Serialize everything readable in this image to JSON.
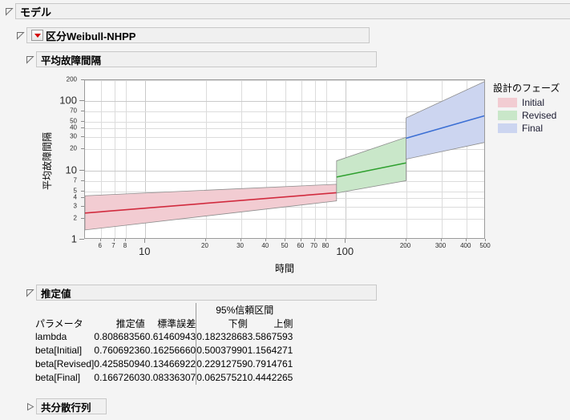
{
  "window": {
    "background": "#f4f4f4"
  },
  "outline": {
    "model": {
      "label": "モデル",
      "expanded": true
    },
    "weibull": {
      "label": "区分Weibull-NHPP",
      "expanded": true,
      "has_red_menu": true
    },
    "mtbf": {
      "label": "平均故障間隔",
      "expanded": true
    },
    "estimates": {
      "label": "推定値",
      "expanded": true
    },
    "covariance": {
      "label": "共分散行列",
      "expanded": false
    }
  },
  "chart_data": {
    "type": "line",
    "title": "平均故障間隔",
    "xlabel": "時間",
    "ylabel": "平均故障間隔",
    "xscale": "log",
    "yscale": "log",
    "xlim": [
      5,
      500
    ],
    "ylim": [
      1,
      200
    ],
    "grid": true,
    "legend_position": "right",
    "legend_title": "設計のフェーズ",
    "x_ticks": [
      {
        "value": 6,
        "label": "6",
        "size": "small"
      },
      {
        "value": 7,
        "label": "7",
        "size": "small"
      },
      {
        "value": 8,
        "label": "8",
        "size": "small"
      },
      {
        "value": 10,
        "label": "10",
        "size": "big"
      },
      {
        "value": 20,
        "label": "20",
        "size": "small"
      },
      {
        "value": 30,
        "label": "30",
        "size": "small"
      },
      {
        "value": 40,
        "label": "40",
        "size": "small"
      },
      {
        "value": 50,
        "label": "50",
        "size": "small"
      },
      {
        "value": 60,
        "label": "60",
        "size": "small"
      },
      {
        "value": 70,
        "label": "70",
        "size": "small"
      },
      {
        "value": 80,
        "label": "80",
        "size": "small"
      },
      {
        "value": 100,
        "label": "100",
        "size": "big"
      },
      {
        "value": 200,
        "label": "200",
        "size": "small"
      },
      {
        "value": 300,
        "label": "300",
        "size": "small"
      },
      {
        "value": 400,
        "label": "400",
        "size": "small"
      },
      {
        "value": 500,
        "label": "500",
        "size": "small"
      }
    ],
    "y_ticks": [
      {
        "value": 1,
        "label": "1",
        "size": "big"
      },
      {
        "value": 2,
        "label": "2",
        "size": "small"
      },
      {
        "value": 3,
        "label": "3",
        "size": "small"
      },
      {
        "value": 4,
        "label": "4",
        "size": "small"
      },
      {
        "value": 5,
        "label": "5",
        "size": "small"
      },
      {
        "value": 7,
        "label": "7",
        "size": "small"
      },
      {
        "value": 10,
        "label": "10",
        "size": "big"
      },
      {
        "value": 20,
        "label": "20",
        "size": "small"
      },
      {
        "value": 30,
        "label": "30",
        "size": "small"
      },
      {
        "value": 40,
        "label": "40",
        "size": "small"
      },
      {
        "value": 50,
        "label": "50",
        "size": "small"
      },
      {
        "value": 70,
        "label": "70",
        "size": "small"
      },
      {
        "value": 100,
        "label": "100",
        "size": "big"
      },
      {
        "value": 200,
        "label": "200",
        "size": "small"
      }
    ],
    "series": [
      {
        "name": "Initial",
        "line_color": "#d12b3e",
        "band_color": "#f2ccd2",
        "x_start": 5.0,
        "x_end": 90.0,
        "fit": [
          [
            5.0,
            2.42
          ],
          [
            90.0,
            4.75
          ]
        ],
        "lower": [
          [
            5.0,
            1.38
          ],
          [
            90.0,
            3.62
          ]
        ],
        "upper": [
          [
            5.0,
            4.3
          ],
          [
            90.0,
            6.3
          ]
        ]
      },
      {
        "name": "Revised",
        "line_color": "#2fa02f",
        "band_color": "#c9e7c9",
        "x_start": 90.0,
        "x_end": 200.0,
        "fit": [
          [
            90.0,
            8.0
          ],
          [
            200.0,
            12.8
          ]
        ],
        "lower": [
          [
            90.0,
            4.7
          ],
          [
            200.0,
            7.1
          ]
        ],
        "upper": [
          [
            90.0,
            13.7
          ],
          [
            200.0,
            30.0
          ]
        ]
      },
      {
        "name": "Final",
        "line_color": "#3b6fd4",
        "band_color": "#ccd5f0",
        "x_start": 200.0,
        "x_end": 500.0,
        "fit": [
          [
            200.0,
            29.0
          ],
          [
            500.0,
            62.0
          ]
        ],
        "lower": [
          [
            200.0,
            14.5
          ],
          [
            500.0,
            25.5
          ]
        ],
        "upper": [
          [
            200.0,
            57.0
          ],
          [
            500.0,
            195.0
          ]
        ]
      }
    ],
    "legend_entries": [
      {
        "label": "Initial",
        "color": "#f2ccd2"
      },
      {
        "label": "Revised",
        "color": "#c9e7c9"
      },
      {
        "label": "Final",
        "color": "#ccd5f0"
      }
    ]
  },
  "estimates_table": {
    "group_header": "95%信頼区間",
    "columns": [
      "パラメータ",
      "推定値",
      "標準誤差",
      "下側",
      "上側"
    ],
    "rows": [
      {
        "parameter": "lambda",
        "estimate": "0.80868356",
        "std_error": "0.61460943",
        "lower": "0.18232868",
        "upper": "3.5867593"
      },
      {
        "parameter": "beta[Initial]",
        "estimate": "0.76069236",
        "std_error": "0.16256660",
        "lower": "0.50037990",
        "upper": "1.1564271"
      },
      {
        "parameter": "beta[Revised]",
        "estimate": "0.42585094",
        "std_error": "0.13466922",
        "lower": "0.22912759",
        "upper": "0.7914761"
      },
      {
        "parameter": "beta[Final]",
        "estimate": "0.16672603",
        "std_error": "0.08336307",
        "lower": "0.06257521",
        "upper": "0.4442265"
      }
    ]
  }
}
